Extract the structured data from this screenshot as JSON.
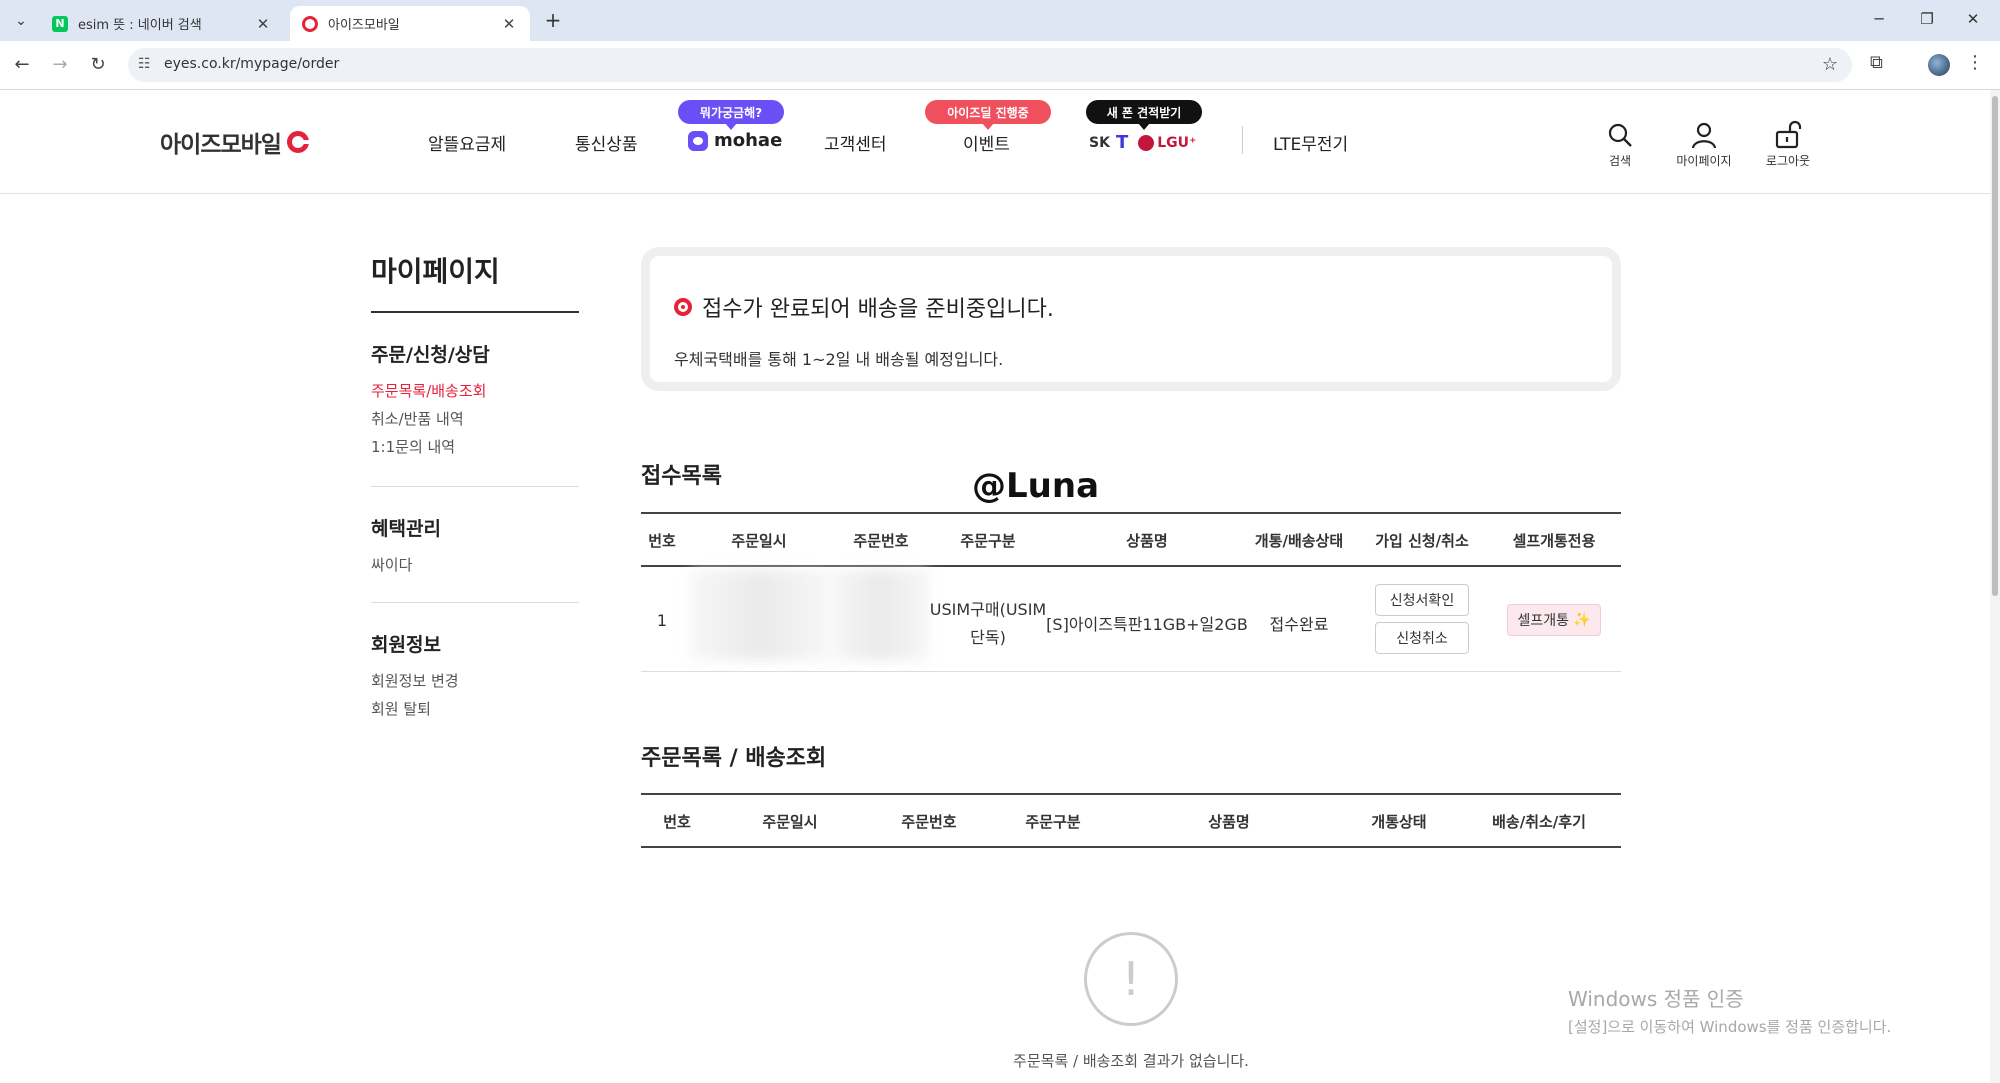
{
  "browser": {
    "tabs": [
      {
        "title": "esim 뜻 : 네이버 검색",
        "favicon": "naver-icon"
      },
      {
        "title": "아이즈모바일",
        "favicon": "eyes-icon",
        "active": true
      }
    ],
    "url": "eyes.co.kr/mypage/order"
  },
  "header": {
    "logo": "아이즈모바일",
    "nav": {
      "plans": "알뜰요금제",
      "devices": "통신상품",
      "mohae": "mohae",
      "support": "고객센터",
      "event": "이벤트",
      "sk": "SK",
      "skt": "T",
      "lgu": "LGU⁺",
      "lte": "LTE무전기"
    },
    "badges": {
      "mohae": "뭐가궁금해?",
      "event": "아이즈딜 진행중",
      "phone": "새 폰 견적받기"
    },
    "icons": {
      "search": "검색",
      "mypage": "마이페이지",
      "logout": "로그아웃"
    }
  },
  "sidebar": {
    "title": "마이페이지",
    "groups": [
      {
        "heading": "주문/신청/상담",
        "links": [
          "주문목록/배송조회",
          "취소/반품 내역",
          "1:1문의 내역"
        ]
      },
      {
        "heading": "혜택관리",
        "links": [
          "싸이다"
        ]
      },
      {
        "heading": "회원정보",
        "links": [
          "회원정보 변경",
          "회원 탈퇴"
        ]
      }
    ]
  },
  "notice": {
    "title": "접수가 완료되어 배송을 준비중입니다.",
    "sub": "우체국택배를 통해 1~2일 내 배송될 예정입니다."
  },
  "overlay": "@Luna",
  "reception": {
    "title": "접수목록",
    "headers": [
      "번호",
      "주문일시",
      "주문번호",
      "주문구분",
      "상품명",
      "개통/배송상태",
      "가입 신청/취소",
      "셀프개통전용"
    ],
    "row": {
      "no": "1",
      "type_line1": "USIM구매(USIM",
      "type_line2": "단독)",
      "product": "[S]아이즈특판11GB+일2GB",
      "status": "접수완료",
      "btn_check": "신청서확인",
      "btn_cancel": "신청취소",
      "btn_self": "셀프개통"
    }
  },
  "orders": {
    "title": "주문목록 / 배송조회",
    "headers": [
      "번호",
      "주문일시",
      "주문번호",
      "주문구분",
      "상품명",
      "개통상태",
      "배송/취소/후기"
    ],
    "empty": "주문목록 / 배송조회 결과가 없습니다."
  },
  "windows": {
    "line1": "Windows 정품 인증",
    "line2": "[설정]으로 이동하여 Windows를 정품 인증합니다."
  }
}
